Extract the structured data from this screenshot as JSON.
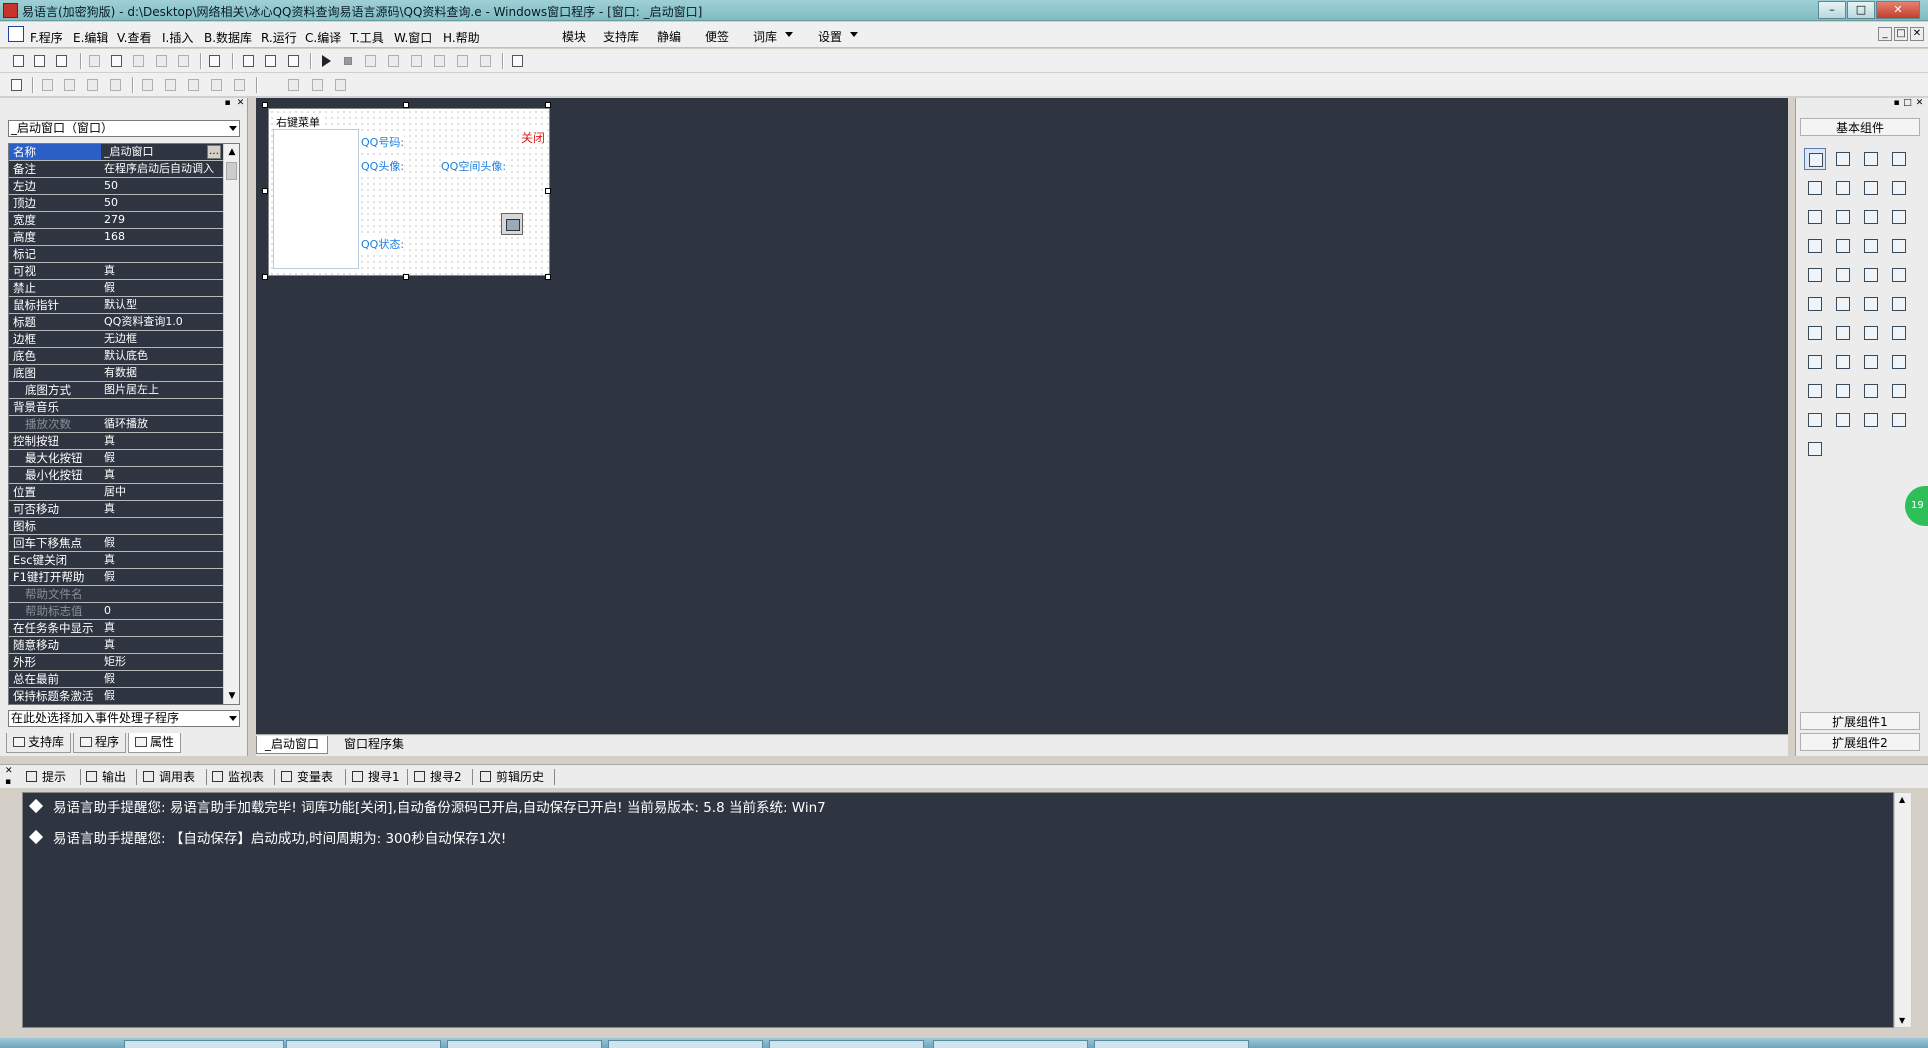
{
  "window": {
    "title": "易语言(加密狗版) - d:\\Desktop\\网络相关\\冰心QQ资料查询易语言源码\\QQ资料查询.e - Windows窗口程序 - [窗口: _启动窗口]",
    "buttons": [
      "–",
      "□",
      "✕"
    ]
  },
  "menu": {
    "items": [
      "F.程序",
      "E.编辑",
      "V.查看",
      "I.插入",
      "B.数据库",
      "R.运行",
      "C.编译",
      "T.工具",
      "W.窗口",
      "H.帮助"
    ],
    "extra": [
      "模块",
      "支持库",
      "静编",
      "便签",
      "词库",
      "设置"
    ],
    "mdi_buttons": [
      "_",
      "□",
      "✕"
    ]
  },
  "left_panel": {
    "header_buttons": [
      "▪",
      "✕"
    ],
    "object_combo": "_启动窗口（窗口）",
    "event_combo": "在此处选择加入事件处理子程序",
    "properties": [
      {
        "name": "名称",
        "value": "_启动窗口",
        "selected": true
      },
      {
        "name": "备注",
        "value": "在程序启动后自动调入"
      },
      {
        "name": "左边",
        "value": "50"
      },
      {
        "name": "顶边",
        "value": "50"
      },
      {
        "name": "宽度",
        "value": "279"
      },
      {
        "name": "高度",
        "value": "168"
      },
      {
        "name": "标记",
        "value": ""
      },
      {
        "name": "可视",
        "value": "真"
      },
      {
        "name": "禁止",
        "value": "假"
      },
      {
        "name": "鼠标指针",
        "value": "默认型"
      },
      {
        "name": "标题",
        "value": "QQ资料查询1.0"
      },
      {
        "name": "边框",
        "value": "无边框"
      },
      {
        "name": "底色",
        "value": "默认底色"
      },
      {
        "name": "底图",
        "value": "有数据"
      },
      {
        "name": "底图方式",
        "value": "图片居左上",
        "indent": true
      },
      {
        "name": "背景音乐",
        "value": ""
      },
      {
        "name": "播放次数",
        "value": "循环播放",
        "indent": true,
        "dim": true
      },
      {
        "name": "控制按钮",
        "value": "真"
      },
      {
        "name": "最大化按钮",
        "value": "假",
        "indent": true
      },
      {
        "name": "最小化按钮",
        "value": "真",
        "indent": true
      },
      {
        "name": "位置",
        "value": "居中"
      },
      {
        "name": "可否移动",
        "value": "真"
      },
      {
        "name": "图标",
        "value": ""
      },
      {
        "name": "回车下移焦点",
        "value": "假"
      },
      {
        "name": "Esc键关闭",
        "value": "真"
      },
      {
        "name": "F1键打开帮助",
        "value": "假"
      },
      {
        "name": "帮助文件名",
        "value": "",
        "indent": true,
        "dim": true
      },
      {
        "name": "帮助标志值",
        "value": "0",
        "indent": true,
        "dim": true
      },
      {
        "name": "在任务条中显示",
        "value": "真"
      },
      {
        "name": "随意移动",
        "value": "真"
      },
      {
        "name": "外形",
        "value": "矩形"
      },
      {
        "name": "总在最前",
        "value": "假"
      },
      {
        "name": "保持标题条激活",
        "value": "假"
      }
    ],
    "tabs": [
      "支持库",
      "程序",
      "属性"
    ]
  },
  "designer": {
    "form": {
      "caption": "右键菜单",
      "labels": [
        "QQ号码:",
        "QQ头像:",
        "QQ空间头像:",
        "QQ状态:"
      ],
      "close": "关闭"
    },
    "tabs": [
      "_启动窗口",
      "窗口程序集"
    ]
  },
  "toolbox": {
    "title": "基本组件",
    "ext1": "扩展组件1",
    "ext2": "扩展组件2",
    "badge": "19"
  },
  "output": {
    "tabs": [
      "提示",
      "输出",
      "调用表",
      "监视表",
      "变量表",
      "搜寻1",
      "搜寻2",
      "剪辑历史"
    ],
    "lines": [
      "易语言助手提醒您:  易语言助手加载完毕! 词库功能[关闭],自动备份源码已开启,自动保存已开启! 当前易版本: 5.8  当前系统: Win7",
      "易语言助手提醒您: 【自动保存】启动成功,时间周期为: 300秒自动保存1次!"
    ]
  }
}
